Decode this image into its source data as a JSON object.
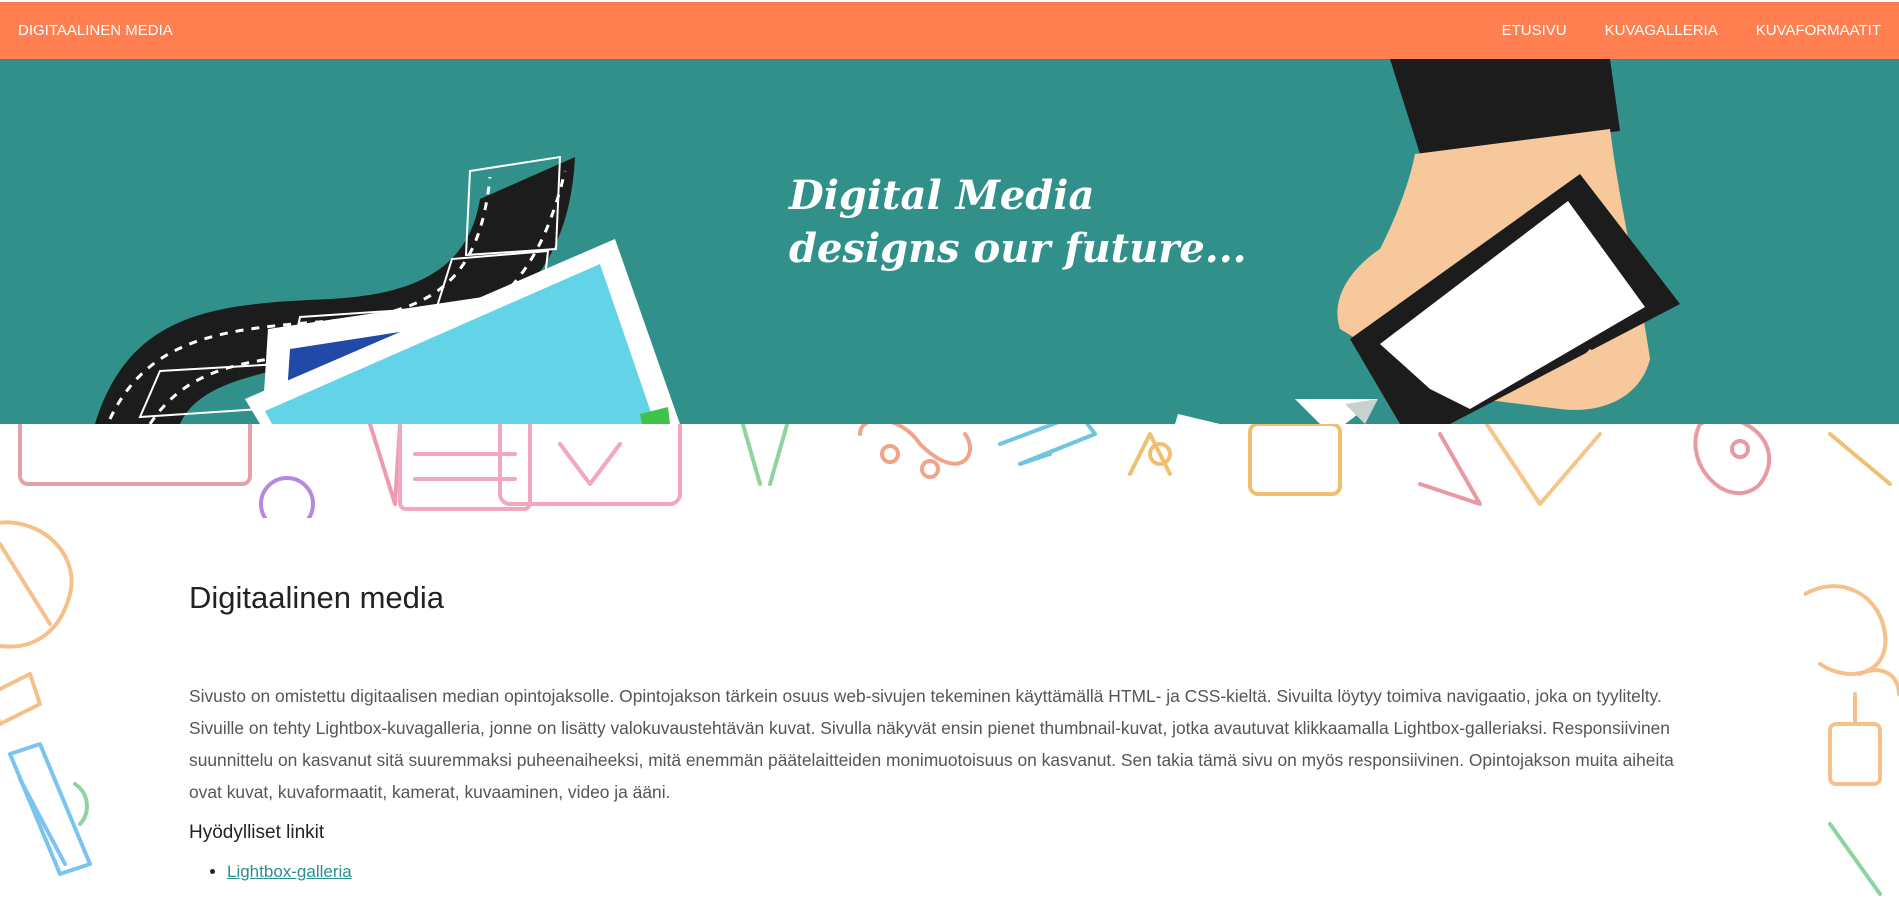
{
  "navbar": {
    "brand": "DIGITAALINEN MEDIA",
    "links": [
      "ETUSIVU",
      "KUVAGALLERIA",
      "KUVAFORMAATIT"
    ]
  },
  "hero": {
    "tagline_line1": "Digital Media",
    "tagline_line2": "designs our future..."
  },
  "main": {
    "title": "Digitaalinen media",
    "intro": "Sivusto on omistettu digitaalisen median opintojaksolle. Opintojakson tärkein osuus web-sivujen tekeminen käyttämällä HTML- ja CSS-kieltä. Sivuilta löytyy toimiva navigaatio, joka on tyylitelty. Sivuille on tehty Lightbox-kuvagalleria, jonne on lisätty valokuvaustehtävän kuvat. Sivulla näkyvät ensin pienet thumbnail-kuvat, jotka avautuvat klikkaamalla Lightbox-galleriaksi. Responsiivinen suunnittelu on kasvanut sitä suuremmaksi puheenaiheeksi, mitä enemmän päätelaitteiden monimuotoisuus on kasvanut. Sen takia tämä sivu on myös responsiivinen. Opintojakson muita aiheita ovat kuvat, kuvaformaatit, kamerat, kuvaaminen, video ja ääni.",
    "links_heading": "Hyödylliset linkit",
    "links": [
      "Lightbox-galleria"
    ]
  },
  "colors": {
    "navbar": "#ff7f50",
    "hero": "#31918a",
    "link": "#2a8f8f"
  },
  "icons": [
    "film-strip-icon",
    "photo-stack-icon",
    "hand-phone-icon",
    "paper-plane-icon"
  ]
}
